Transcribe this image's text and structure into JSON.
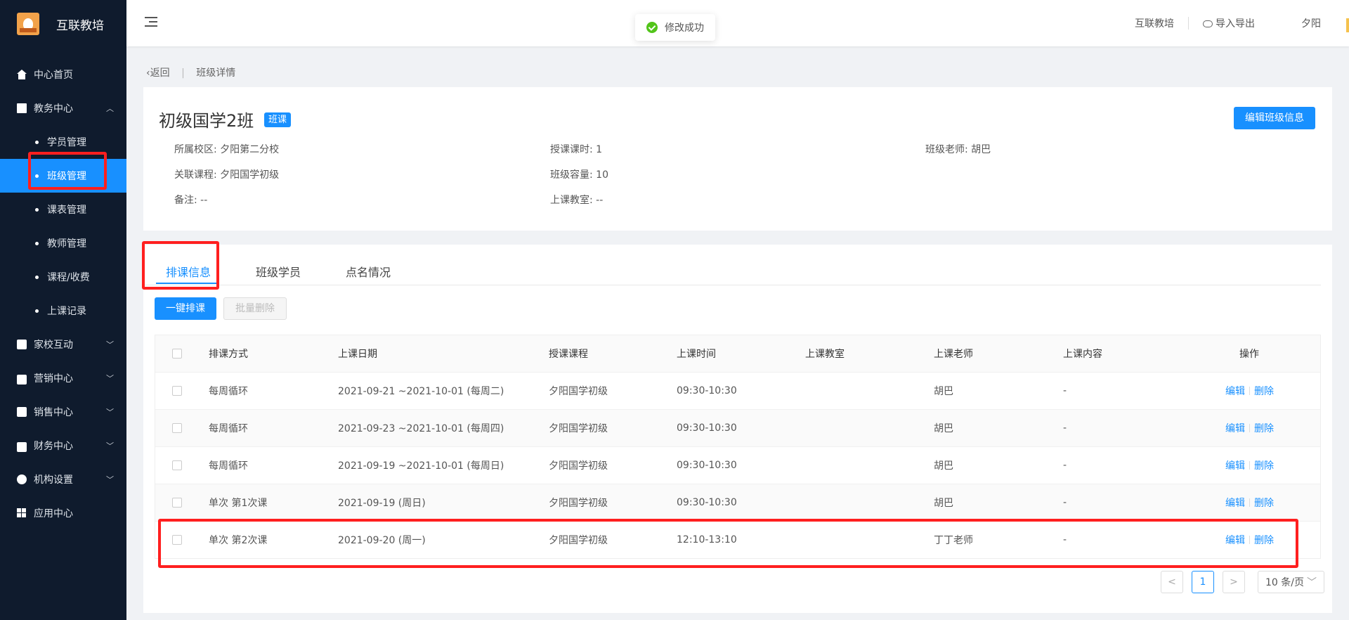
{
  "sidebar": {
    "title": "互联教培",
    "items": [
      {
        "label": "中心首页"
      },
      {
        "label": "教务中心"
      },
      {
        "label": "学员管理"
      },
      {
        "label": "班级管理"
      },
      {
        "label": "课表管理"
      },
      {
        "label": "教师管理"
      },
      {
        "label": "课程/收费"
      },
      {
        "label": "上课记录"
      },
      {
        "label": "家校互动"
      },
      {
        "label": "营销中心"
      },
      {
        "label": "销售中心"
      },
      {
        "label": "财务中心"
      },
      {
        "label": "机构设置"
      },
      {
        "label": "应用中心"
      }
    ]
  },
  "header": {
    "org": "互联教培",
    "import_export": "导入导出",
    "user": "夕阳"
  },
  "toast": {
    "message": "修改成功"
  },
  "breadcrumb": {
    "back": "返回",
    "current": "班级详情"
  },
  "class_info": {
    "name": "初级国学2班",
    "badge": "班课",
    "edit_button": "编辑班级信息",
    "campus": "所属校区: 夕阳第二分校",
    "course": "关联课程: 夕阳国学初级",
    "remark": "备注: --",
    "hours": "授课课时: 1",
    "capacity": "班级容量: 10",
    "room": "上课教室: --",
    "teacher": "班级老师:  胡巴"
  },
  "tabs": [
    "排课信息",
    "班级学员",
    "点名情况"
  ],
  "actions": {
    "schedule": "一键排课",
    "batch_delete": "批量删除"
  },
  "table": {
    "headers": [
      "排课方式",
      "上课日期",
      "授课课程",
      "上课时间",
      "上课教室",
      "上课老师",
      "上课内容",
      "操作"
    ],
    "edit": "编辑",
    "delete": "删除",
    "rows": [
      {
        "mode": "每周循环",
        "date": "2021-09-21 ~2021-10-01 (每周二)",
        "course": "夕阳国学初级",
        "time": "09:30-10:30",
        "room": "",
        "teacher": "胡巴",
        "content": "-"
      },
      {
        "mode": "每周循环",
        "date": "2021-09-23 ~2021-10-01 (每周四)",
        "course": "夕阳国学初级",
        "time": "09:30-10:30",
        "room": "",
        "teacher": "胡巴",
        "content": "-"
      },
      {
        "mode": "每周循环",
        "date": "2021-09-19 ~2021-10-01 (每周日)",
        "course": "夕阳国学初级",
        "time": "09:30-10:30",
        "room": "",
        "teacher": "胡巴",
        "content": "-"
      },
      {
        "mode": "单次 第1次课",
        "date": "2021-09-19 (周日)",
        "course": "夕阳国学初级",
        "time": "09:30-10:30",
        "room": "",
        "teacher": "胡巴",
        "content": "-"
      },
      {
        "mode": "单次 第2次课",
        "date": "2021-09-20 (周一)",
        "course": "夕阳国学初级",
        "time": "12:10-13:10",
        "room": "",
        "teacher": "丁丁老师",
        "content": "-"
      }
    ]
  },
  "pagination": {
    "prev": "<",
    "page": "1",
    "next": ">",
    "page_size": "10 条/页"
  }
}
